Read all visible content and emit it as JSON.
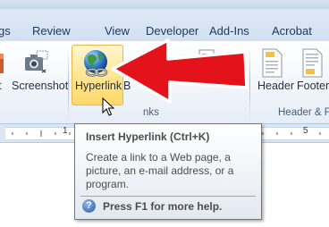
{
  "tabs": [
    {
      "label": "gs"
    },
    {
      "label": "Review"
    },
    {
      "label": "View"
    },
    {
      "label": "Developer"
    },
    {
      "label": "Add-Ins"
    },
    {
      "label": "Acrobat"
    }
  ],
  "buttons": {
    "screenshot_label": "Screenshot",
    "hyperlink_label": "Hyperlink",
    "bookmark_partial_label": "B",
    "header_label": "Header",
    "footer_label": "Footer",
    "left_partial_label": "t"
  },
  "groups": {
    "links_label": "nks",
    "header_footer_label": "Header & F"
  },
  "ruler": {
    "marks": [
      "1",
      "5"
    ]
  },
  "tooltip": {
    "title": "Insert Hyperlink (Ctrl+K)",
    "lines": [
      "Create a link to a Web page, a",
      "picture, an e-mail address, or a",
      "program."
    ],
    "help_text": "Press F1 for more help.",
    "help_icon_glyph": "?"
  },
  "colors": {
    "arrow": "#e3121b",
    "tooltip_border": "#767676",
    "ribbon_tab_text": "#1e395b"
  }
}
